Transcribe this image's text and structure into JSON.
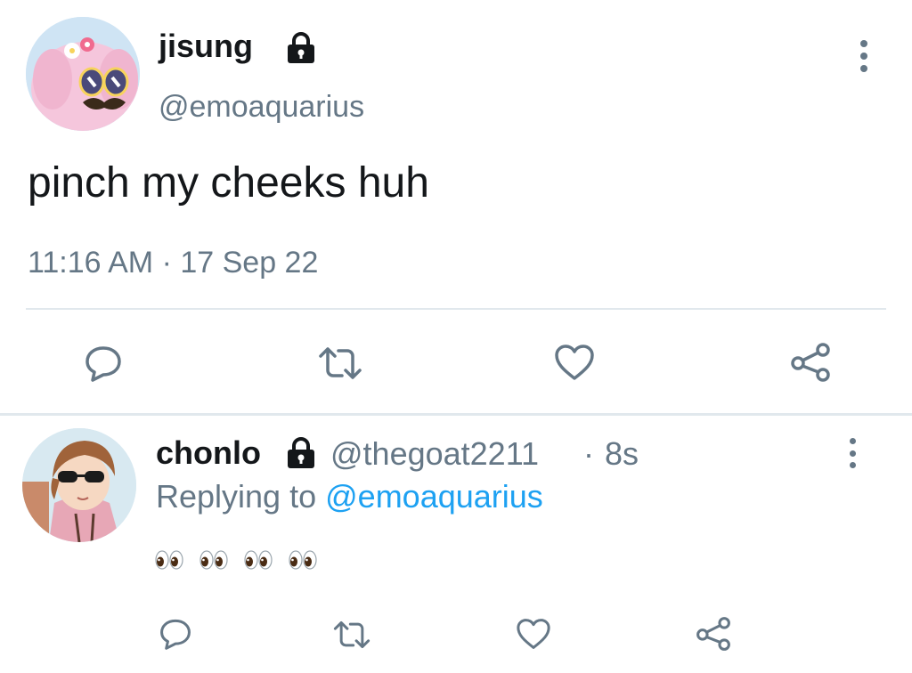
{
  "main_tweet": {
    "display_name": "jisung",
    "handle": "@emoaquarius",
    "text": "pinch my cheeks huh",
    "timestamp": "11:16 AM · 17 Sep 22"
  },
  "reply_tweet": {
    "display_name": "chonlo",
    "handle": "@thegoat2211",
    "separator": "·",
    "time_ago": "8s",
    "replying_prefix": "Replying to",
    "replying_handle": "@emoaquarius",
    "text": "👀 👀 👀 👀"
  },
  "icons": {
    "reply": "reply-bubble-icon",
    "retweet": "retweet-icon",
    "like": "heart-icon",
    "share": "share-icon",
    "lock": "lock-icon",
    "more": "more-vertical-icon"
  },
  "colors": {
    "text": "#14171a",
    "secondary": "#657786",
    "link": "#1da1f2",
    "divider": "#e1e8ed"
  }
}
